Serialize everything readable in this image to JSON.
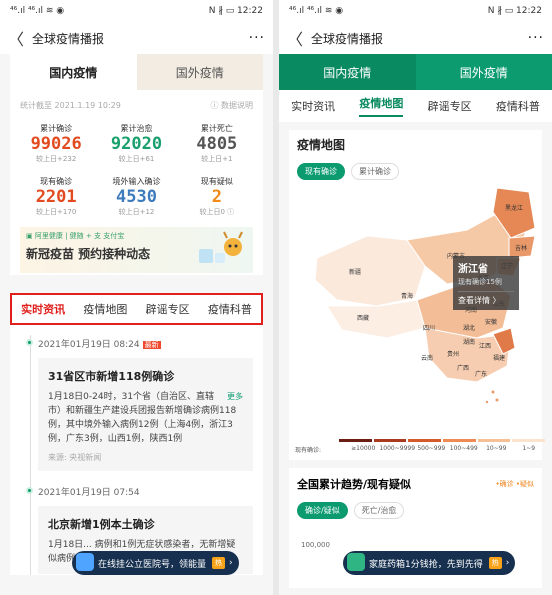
{
  "status_left": "⁴⁶.ıl ⁴⁶.ıl ≋ ◉",
  "status_right": "N ∦ ▭ 12:22",
  "nav": {
    "back": "〈",
    "title": "全球疫情播报",
    "more": "···"
  },
  "main_tabs": [
    "国内疫情",
    "国外疫情"
  ],
  "stamp": {
    "time": "统计截至 2021.1.19 10:29",
    "note": "ⓘ 数据说明"
  },
  "stats": [
    {
      "label": "累计确诊",
      "value": "99026",
      "delta": "较上日+232",
      "color": "#e24b1f"
    },
    {
      "label": "累计治愈",
      "value": "92020",
      "delta": "较上日+61",
      "color": "#19a06c"
    },
    {
      "label": "累计死亡",
      "value": "4805",
      "delta": "较上日+1",
      "color": "#555555"
    },
    {
      "label": "现有确诊",
      "value": "2201",
      "delta": "较上日+170",
      "color": "#e24b1f"
    },
    {
      "label": "境外输入确诊",
      "value": "4530",
      "delta": "较上日+12",
      "color": "#3d7bbd"
    },
    {
      "label": "现有疑似",
      "value": "2",
      "delta": "较上日0 ⓘ",
      "color": "#f18a18"
    }
  ],
  "banner": {
    "sponsors": "▣ 阿里健康 | 健随 + 支 支付宝",
    "text": "新冠疫苗 预约接种动态"
  },
  "subtabs": [
    "实时资讯",
    "疫情地图",
    "辟谣专区",
    "疫情科普"
  ],
  "entries": [
    {
      "date": "2021年01月19日 08:24",
      "badge": "最新",
      "title": "31省区市新增118例确诊",
      "body": "1月18日0-24时，31个省（自治区、直辖市）和新疆生产建设兵团报告新增确诊病例118例，其中境外输入病例12例（上海4例，浙江3例，广东3例，山西1例，陕西1例",
      "more": "更多",
      "source": "来源: 央视新闻"
    },
    {
      "date": "2021年01月19日 07:54",
      "title": "北京新增1例本土确诊",
      "body": "1月18日... 病例和1例无症状感染者，无新增疑似病例;"
    }
  ],
  "float_left": {
    "text": "在线挂公立医院号，领能量",
    "badge": "热"
  },
  "float_right": {
    "text": "家庭药箱1分钱抢，先到先得",
    "badge": "热"
  },
  "map": {
    "title": "疫情地图",
    "filters": [
      "现有确诊",
      "累计确诊"
    ],
    "tooltip": {
      "province": "浙江省",
      "count": "现有确诊15例",
      "detail": "查看详情 〉"
    },
    "provinces": [
      "黑龙江",
      "吉林",
      "辽宁",
      "内蒙古",
      "北京",
      "新疆",
      "西藏",
      "青海",
      "四川",
      "贵州",
      "云南",
      "广西",
      "广东",
      "湖北",
      "安徽",
      "山东",
      "河南",
      "江西",
      "福建",
      "湖南"
    ],
    "legend_label": "现有确诊:",
    "legend": [
      "≥10000",
      "1000~9999",
      "500~999",
      "100~499",
      "10~99",
      "1~9"
    ],
    "legend_colors": [
      "#6b1f14",
      "#a93a1f",
      "#d45a2a",
      "#ee8a54",
      "#f7bf94",
      "#fbe3ce"
    ]
  },
  "trend": {
    "title": "全国累计趋势/现有疑似",
    "legend": "•确诊 •疑似",
    "filters": [
      "确诊/疑似",
      "死亡/治愈"
    ],
    "tick": "100,000"
  }
}
